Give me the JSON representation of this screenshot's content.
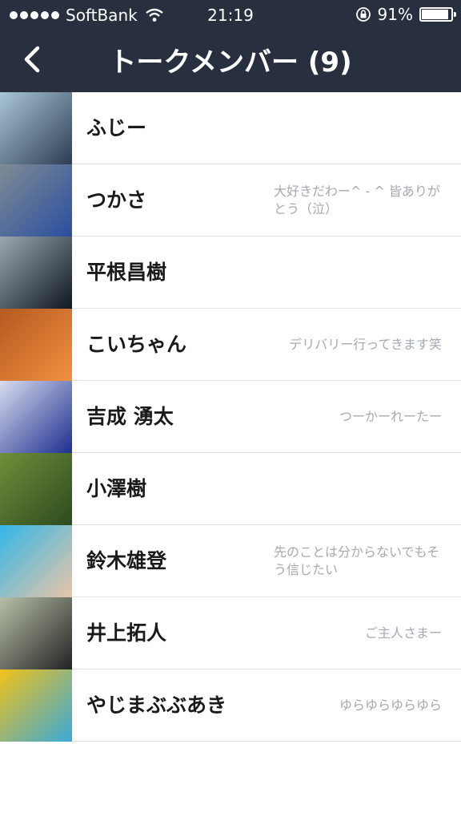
{
  "status_bar": {
    "carrier": "SoftBank",
    "time": "21:19",
    "battery": "91%",
    "battery_level": 0.91,
    "icons": [
      "signal-dots",
      "wifi-icon",
      "rotation-lock-icon",
      "battery-icon"
    ]
  },
  "header": {
    "back_icon": "chevron-left-icon",
    "title": "トークメンバー (9)"
  },
  "members": [
    {
      "name": "ふじー",
      "status": "",
      "avatar": {
        "colors": [
          "#a9c6d6",
          "#2d3d54"
        ]
      }
    },
    {
      "name": "つかさ",
      "status": "大好きだわー^ - ^ 皆ありがとう（泣）",
      "avatar": {
        "colors": [
          "#7f8b94",
          "#2a4fa0"
        ]
      }
    },
    {
      "name": "平根昌樹",
      "status": "",
      "avatar": {
        "colors": [
          "#9aa7b0",
          "#101822"
        ]
      }
    },
    {
      "name": "こいちゃん",
      "status": "デリバリー行ってきます笑",
      "avatar": {
        "colors": [
          "#b55a20",
          "#f09040"
        ]
      }
    },
    {
      "name": "吉成 湧太",
      "status": "つーかーれーたー",
      "avatar": {
        "colors": [
          "#d8dcef",
          "#1e2f8f"
        ]
      }
    },
    {
      "name": "小澤樹",
      "status": "",
      "avatar": {
        "colors": [
          "#6f8f3a",
          "#2d4a1e"
        ]
      }
    },
    {
      "name": "鈴木雄登",
      "status": "先のことは分からないでもそう信じたい",
      "avatar": {
        "colors": [
          "#33b7e8",
          "#e9c5a8"
        ]
      }
    },
    {
      "name": "井上拓人",
      "status": "ご主人さまー",
      "avatar": {
        "colors": [
          "#b7c0a8",
          "#222222"
        ]
      }
    },
    {
      "name": "やじまぶぶあき",
      "status": "ゆらゆらゆらゆら",
      "avatar": {
        "colors": [
          "#f2c21a",
          "#3aa9d8"
        ]
      }
    }
  ]
}
